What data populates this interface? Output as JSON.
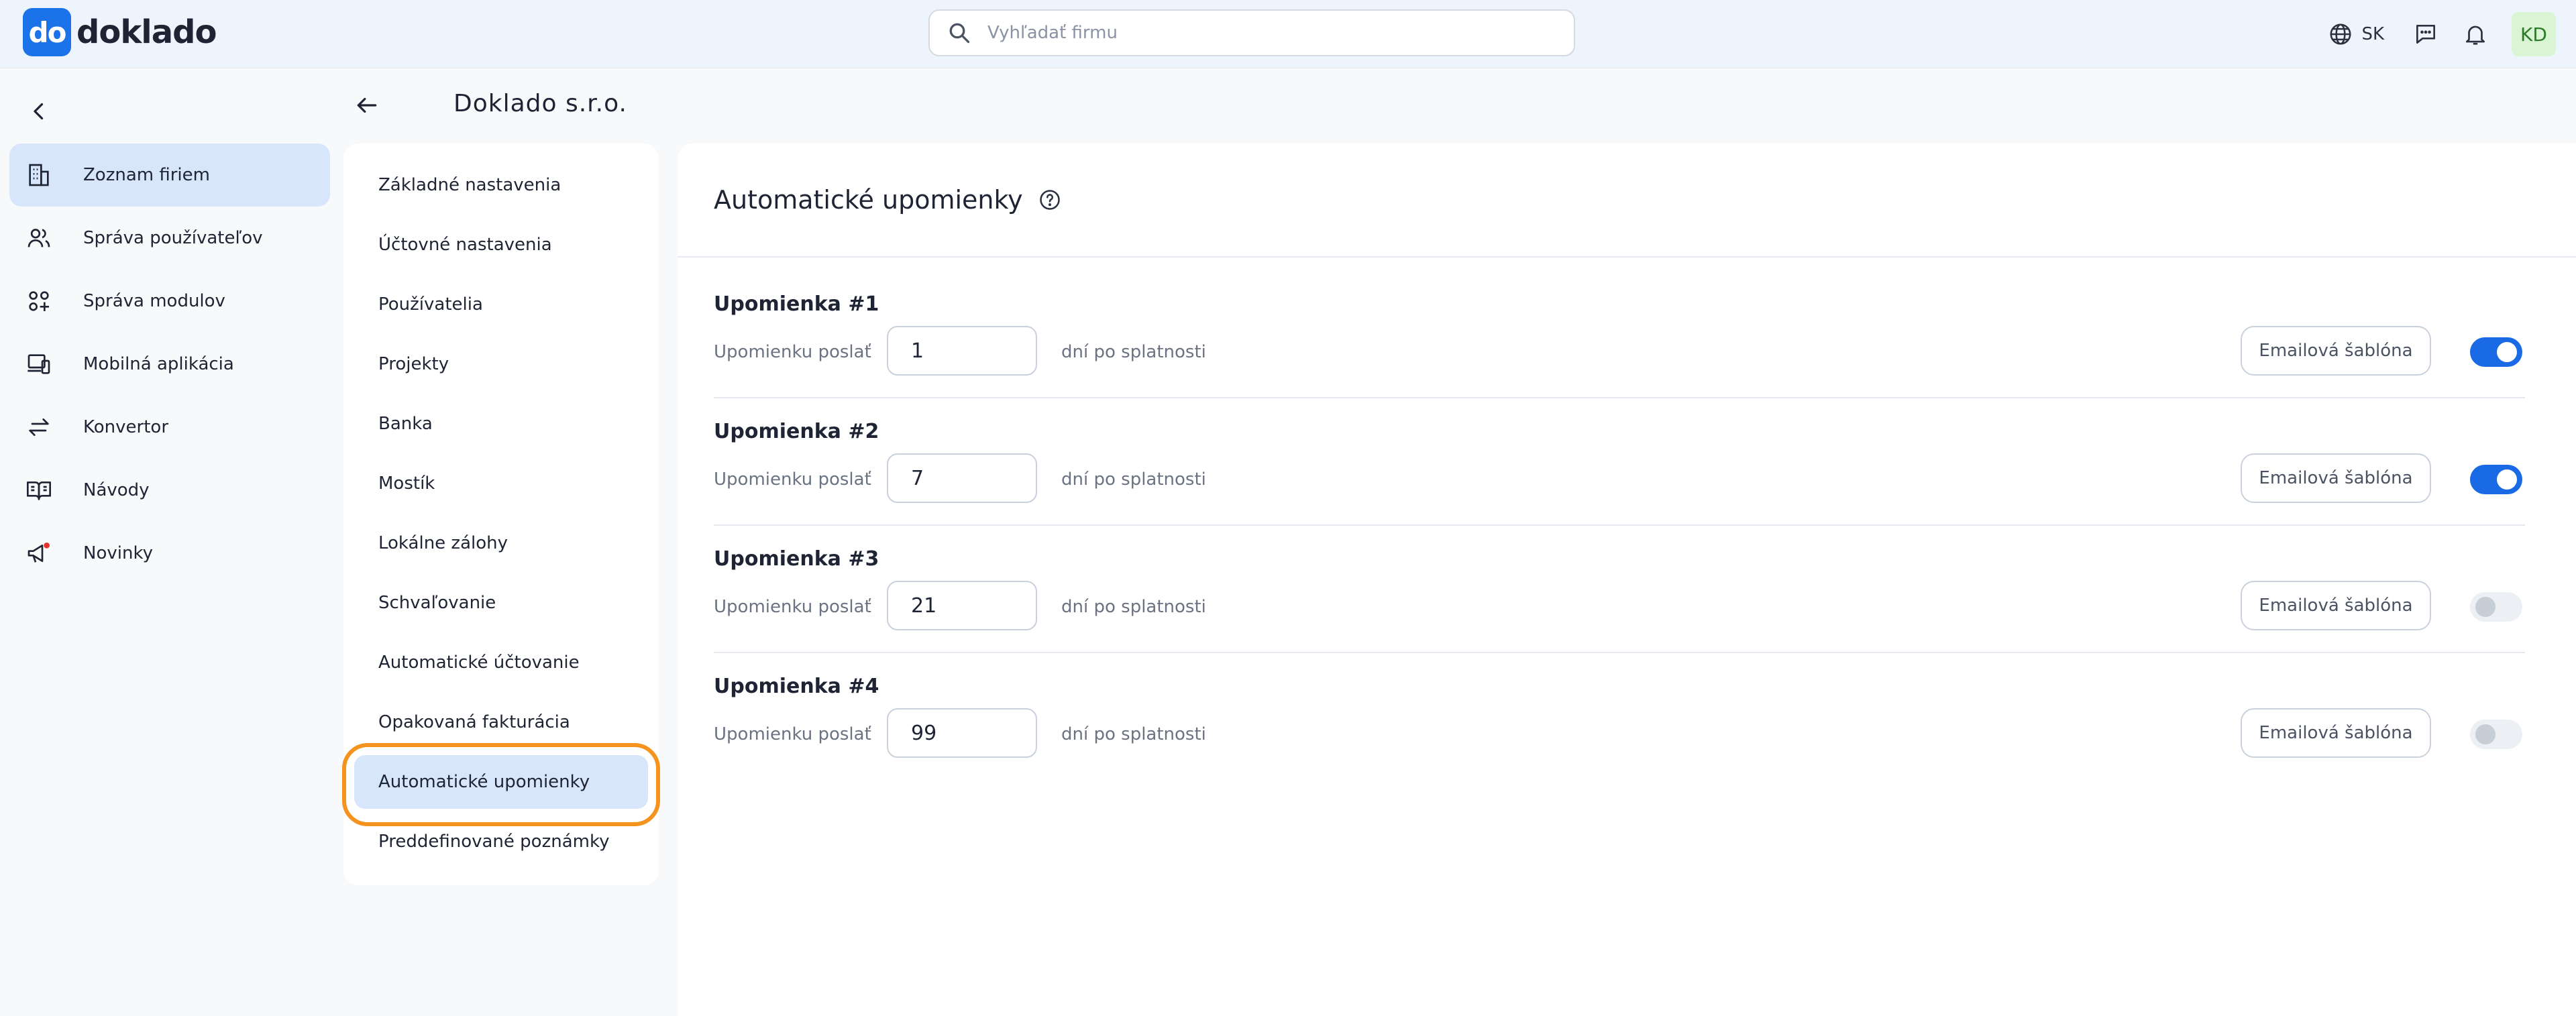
{
  "brand": {
    "logo_mark": "do",
    "name": "doklado",
    "accent": "#1a73e8"
  },
  "header": {
    "search_placeholder": "Vyhľadať firmu",
    "language": "SK",
    "avatar_initials": "KD"
  },
  "sidebar": {
    "items": [
      {
        "label": "Zoznam firiem",
        "icon": "building-icon",
        "active": true
      },
      {
        "label": "Správa používateľov",
        "icon": "users-icon",
        "active": false
      },
      {
        "label": "Správa modulov",
        "icon": "modules-icon",
        "active": false
      },
      {
        "label": "Mobilná aplikácia",
        "icon": "mobile-app-icon",
        "active": false
      },
      {
        "label": "Konvertor",
        "icon": "converter-icon",
        "active": false
      },
      {
        "label": "Návody",
        "icon": "book-icon",
        "active": false
      },
      {
        "label": "Novinky",
        "icon": "megaphone-icon",
        "active": false
      }
    ]
  },
  "company": {
    "title": "Doklado s.r.o."
  },
  "settings_menu": {
    "items": [
      "Základné nastavenia",
      "Účtovné nastavenia",
      "Používatelia",
      "Projekty",
      "Banka",
      "Mostík",
      "Lokálne zálohy",
      "Schvaľovanie",
      "Automatické účtovanie",
      "Opakovaná fakturácia",
      "Automatické upomienky",
      "Preddefinované poznámky"
    ],
    "active_index": 10,
    "highlight_color": "#f5931f"
  },
  "main": {
    "title": "Automatické upomienky",
    "reminders": [
      {
        "title": "Upomienka #1",
        "send_label": "Upomienku poslať",
        "days": "1",
        "after_label": "dní po splatnosti",
        "template_label": "Emailová šablóna",
        "enabled": true
      },
      {
        "title": "Upomienka #2",
        "send_label": "Upomienku poslať",
        "days": "7",
        "after_label": "dní po splatnosti",
        "template_label": "Emailová šablóna",
        "enabled": true
      },
      {
        "title": "Upomienka #3",
        "send_label": "Upomienku poslať",
        "days": "21",
        "after_label": "dní po splatnosti",
        "template_label": "Emailová šablóna",
        "enabled": false
      },
      {
        "title": "Upomienka #4",
        "send_label": "Upomienku poslať",
        "days": "99",
        "after_label": "dní po splatnosti",
        "template_label": "Emailová šablóna",
        "enabled": false
      }
    ]
  }
}
